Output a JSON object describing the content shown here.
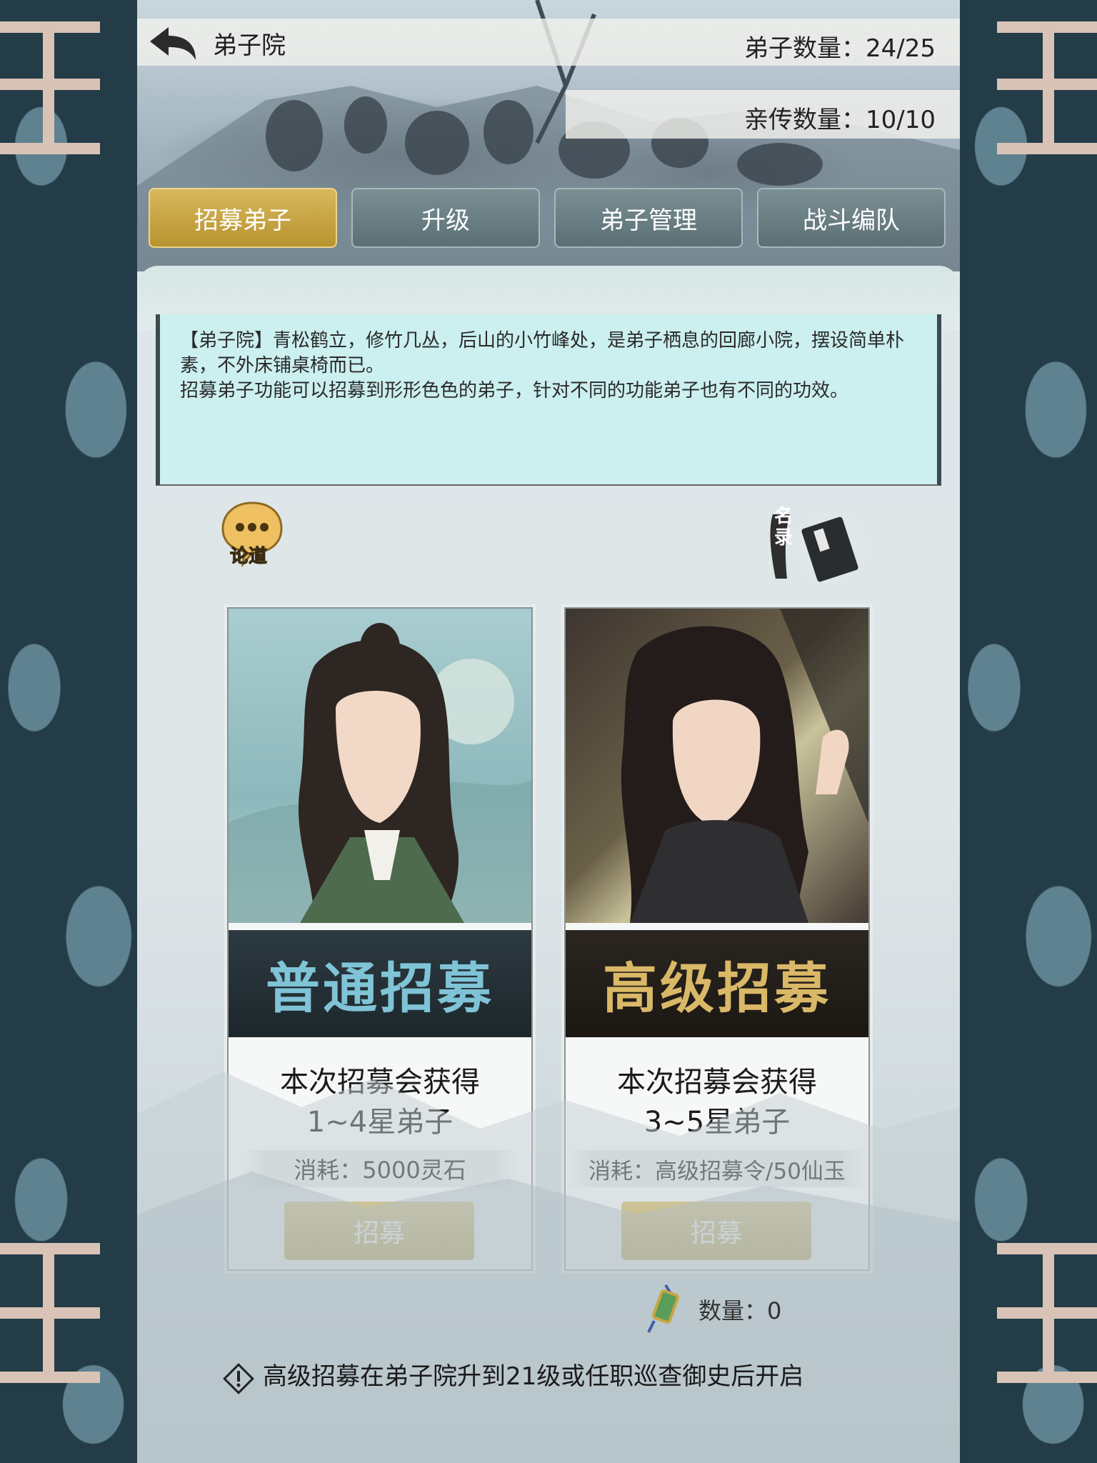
{
  "header": {
    "title": "弟子院",
    "disciple_count": "弟子数量：24/25",
    "inner_disciple_count": "亲传数量：10/10"
  },
  "tabs": [
    {
      "label": "招募弟子",
      "active": true
    },
    {
      "label": "升级",
      "active": false
    },
    {
      "label": "弟子管理",
      "active": false
    },
    {
      "label": "战斗编队",
      "active": false
    }
  ],
  "description": {
    "line1": "【弟子院】青松鹤立，修竹几丛，后山的小竹峰处，是弟子栖息的回廊小院，摆设简单朴素，不外床铺桌椅而已。",
    "line2": "招募弟子功能可以招募到形形色色的弟子，针对不同的功能弟子也有不同的功效。"
  },
  "chat_button": {
    "label": "论道",
    "icon": "speech-bubble-icon"
  },
  "roster_button": {
    "label": "名录",
    "icon": "book-icon"
  },
  "cards": [
    {
      "ribbon": "普通招募",
      "info_line1": "本次招募会获得",
      "info_line2": "1~4星弟子",
      "cost": "消耗：5000灵石",
      "button": "招募",
      "ribbon_color": "#7fc3d6"
    },
    {
      "ribbon": "高级招募",
      "info_line1": "本次招募会获得",
      "info_line2": "3~5星弟子",
      "cost": "消耗：高级招募令/50仙玉",
      "button": "招募",
      "ribbon_color": "#d9b867"
    }
  ],
  "token_quantity": "数量：0",
  "notice": "高级招募在弟子院升到21级或任职巡查御史后开启",
  "colors": {
    "gold": "#c9a544",
    "teal_panel": "#ccefef"
  }
}
